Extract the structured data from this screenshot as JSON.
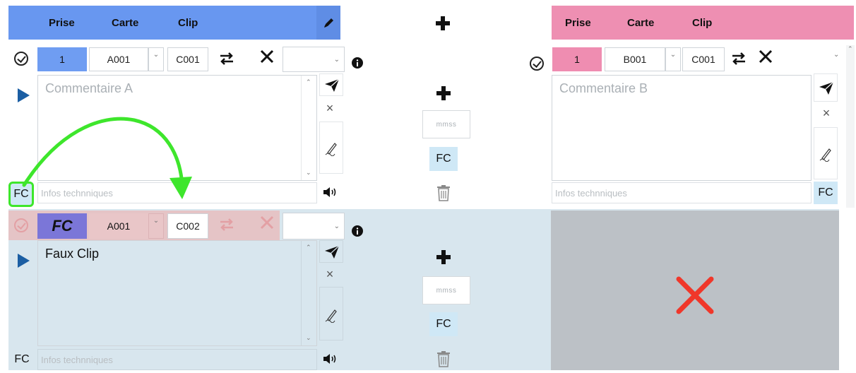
{
  "colors": {
    "accent_a": "#6897f0",
    "accent_b": "#ee8fb2",
    "row_bg": "#d8e6ee",
    "fc_badge": "#cfe8f6",
    "annotation": "#3ee62c",
    "delete_mark": "#f0372a"
  },
  "header_a": {
    "prise": "Prise",
    "carte": "Carte",
    "clip": "Clip",
    "edit_icon": "pencil-icon"
  },
  "header_mid": {
    "add_icon": "plus-icon"
  },
  "header_b": {
    "prise": "Prise",
    "carte": "Carte",
    "clip": "Clip"
  },
  "row1": {
    "a": {
      "prise": "1",
      "carte": "A001",
      "clip": "C001",
      "comment_placeholder": "Commentaire A",
      "info_placeholder": "Infos technniques",
      "fc_label": "FC"
    },
    "mid": {
      "time_placeholder": "mmss",
      "fc_label": "FC"
    },
    "b": {
      "prise": "1",
      "carte": "B001",
      "clip": "C001",
      "comment_placeholder": "Commentaire B",
      "info_placeholder": "Infos technniques",
      "fc_label": "FC"
    }
  },
  "row2": {
    "a": {
      "prise": "FC",
      "carte": "A001",
      "clip": "C002",
      "comment": "Faux Clip",
      "info_placeholder": "Infos technniques",
      "fc_label": "FC"
    },
    "mid": {
      "time_placeholder": "mmss",
      "fc_label": "FC"
    }
  }
}
